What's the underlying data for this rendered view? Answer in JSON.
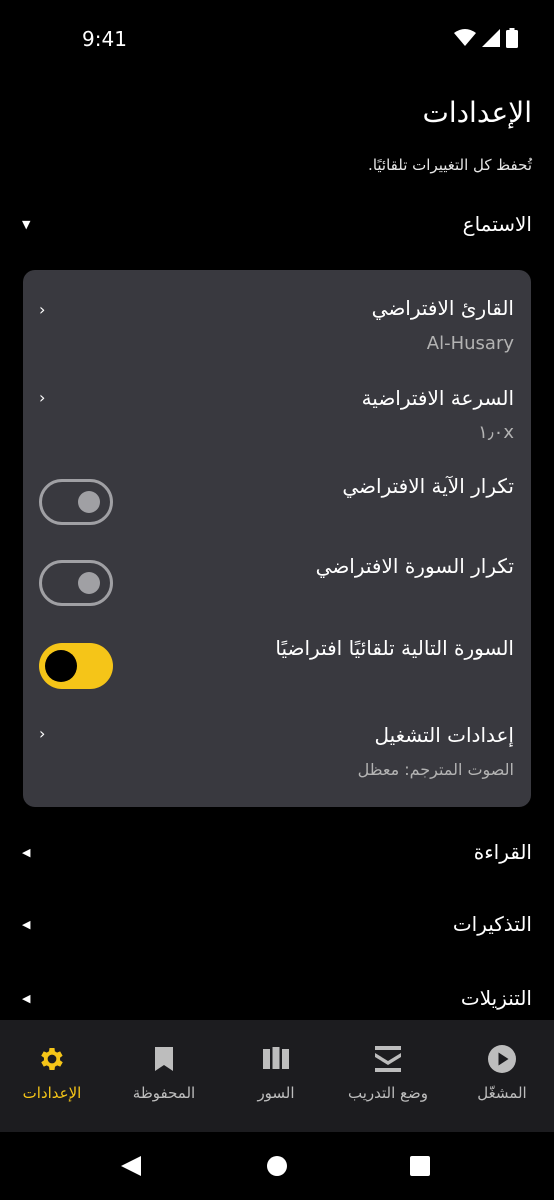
{
  "status_bar": {
    "time": "9:41"
  },
  "header": {
    "title": "الإعدادات",
    "subtitle": "تُحفظ كل التغييرات تلقائيًا."
  },
  "sections": {
    "listening": "الاستماع",
    "reading": "القراءة",
    "reminders": "التذكيرات",
    "downloads": "التنزيلات"
  },
  "listening_card": {
    "default_reader": {
      "title": "القارئ الافتراضي",
      "value": "Al-Husary"
    },
    "default_speed": {
      "title": "السرعة الافتراضية",
      "value": "١٫٠x"
    },
    "repeat_ayah": {
      "title": "تكرار الآية الافتراضي",
      "enabled": false
    },
    "repeat_surah": {
      "title": "تكرار السورة الافتراضي",
      "enabled": false
    },
    "auto_next_surah": {
      "title": "السورة التالية تلقائيًا افتراضيًا",
      "enabled": true
    },
    "playback_settings": {
      "title": "إعدادات التشغيل",
      "value": "الصوت المترجم: معظل"
    }
  },
  "bottom_nav": {
    "items": [
      {
        "label": "الإعدادات",
        "icon": "gear-icon",
        "active": true
      },
      {
        "label": "المحفوظة",
        "icon": "bookmark-icon",
        "active": false
      },
      {
        "label": "السور",
        "icon": "library-icon",
        "active": false
      },
      {
        "label": "وضع التدريب",
        "icon": "stack-icon",
        "active": false
      },
      {
        "label": "المشغّل",
        "icon": "play-icon",
        "active": false
      }
    ]
  },
  "colors": {
    "accent": "#f5c518",
    "card_bg": "#39393f",
    "nav_bg": "#1c1c1f",
    "background": "#000000"
  }
}
